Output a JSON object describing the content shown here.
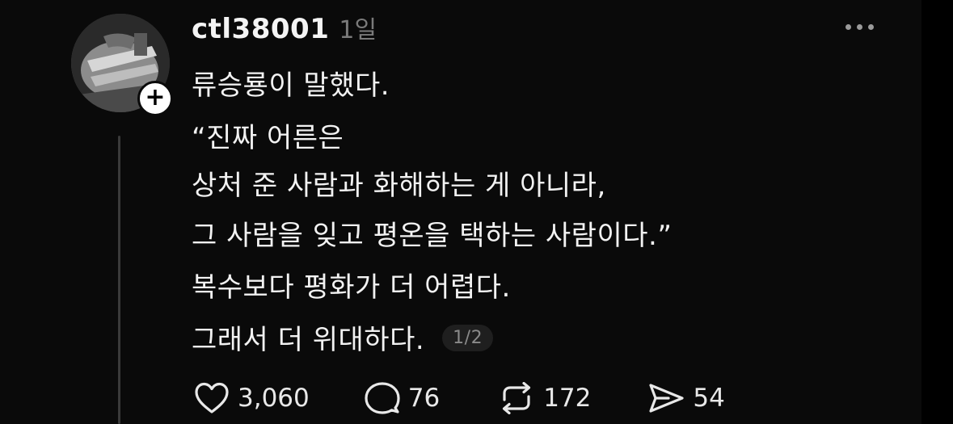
{
  "post": {
    "username": "ctl38001",
    "time": "1일",
    "lines": [
      "류승룡이 말했다.",
      "“진짜 어른은",
      "상처 준 사람과 화해하는 게 아니라,",
      "그 사람을 잊고 평온을 택하는 사람이다.”",
      "복수보다 평화가 더 어렵다.",
      "그래서 더 위대하다."
    ],
    "page_indicator": "1/2"
  },
  "actions": {
    "likes": "3,060",
    "comments": "76",
    "reposts": "172",
    "shares": "54"
  },
  "icons": {
    "like": "heart-icon",
    "comment": "comment-bubble-icon",
    "repost": "repost-icon",
    "share": "send-icon",
    "more": "more-dots-icon",
    "follow": "plus-icon"
  }
}
